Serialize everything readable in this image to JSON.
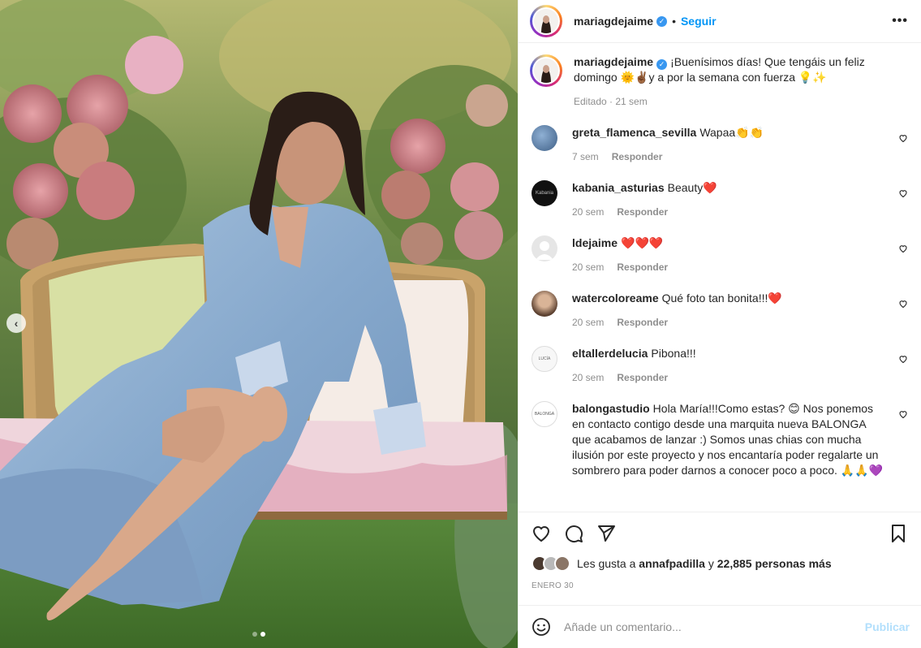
{
  "post": {
    "username": "mariagdejaime",
    "follow_label": "Seguir",
    "separator": "•",
    "more_label": "•••",
    "carousel_prev": "‹",
    "caption_text": "¡Buenísimos días! Que tengáis un feliz domingo 🌞✌🏾y a por la semana con fuerza 💡✨",
    "caption_meta": "Editado · 21 sem"
  },
  "comments": [
    {
      "username": "greta_flamenca_sevilla",
      "text": "Wapaa👏👏",
      "time": "7 sem",
      "reply": "Responder",
      "avatar_color": "#5a7fa8"
    },
    {
      "username": "kabania_asturias",
      "text": "Beauty❤️",
      "time": "20 sem",
      "reply": "Responder",
      "avatar_color": "#111111"
    },
    {
      "username": "ldejaime",
      "text": "❤️❤️❤️",
      "time": "20 sem",
      "reply": "Responder",
      "avatar_color": "#e6e6e6"
    },
    {
      "username": "watercoloreame",
      "text": "Qué foto tan bonita!!!❤️",
      "time": "20 sem",
      "reply": "Responder",
      "avatar_color": "#c7a98d"
    },
    {
      "username": "eltallerdelucia",
      "text": "Pibona!!!",
      "time": "20 sem",
      "reply": "Responder",
      "avatar_color": "#f7f7f7"
    },
    {
      "username": "balongastudio",
      "text": "Hola María!!!Como estas? 😊 Nos ponemos en contacto contigo desde una marquita nueva BALONGA que acabamos de lanzar :) Somos unas chias con mucha ilusión por este proyecto y nos encantaría poder regalarte un sombrero para poder darnos a conocer poco a poco. 🙏🙏💜",
      "time": "",
      "reply": "",
      "avatar_color": "#ffffff"
    }
  ],
  "avatar_texts": {
    "kabania": "Kabania",
    "taller": "LUCÍA",
    "balonga": "BALONGA"
  },
  "likes": {
    "prefix": "Les gusta a",
    "user": "annafpadilla",
    "connector": "y",
    "count_text": "22,885 personas más"
  },
  "date": "ENERO 30",
  "add_comment": {
    "placeholder": "Añade un comentario...",
    "publish_label": "Publicar"
  },
  "colors": {
    "link_blue": "#0095f6",
    "publish_disabled": "#b2dffc",
    "verified_blue": "#3897f0",
    "muted_text": "#8e8e8e",
    "primary_text": "#262626"
  },
  "icons": [
    "chevron-left-icon",
    "verified-icon",
    "more-icon",
    "heart-icon",
    "comment-icon",
    "share-icon",
    "bookmark-icon",
    "emoji-icon"
  ]
}
